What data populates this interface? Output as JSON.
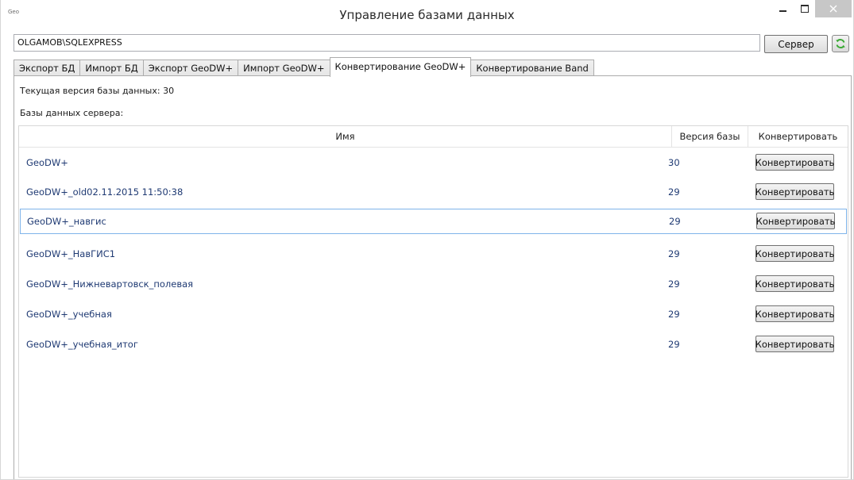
{
  "window": {
    "app_label": "Geo",
    "title": "Управление базами данных"
  },
  "server": {
    "value": "OLGAMOB\\SQLEXPRESS",
    "button_label": "Сервер",
    "refresh_icon": "refresh-icon"
  },
  "tabs": [
    {
      "label": "Экспорт БД",
      "active": false
    },
    {
      "label": "Импорт БД",
      "active": false
    },
    {
      "label": "Экспорт GeoDW+",
      "active": false
    },
    {
      "label": "Импорт GeoDW+",
      "active": false
    },
    {
      "label": "Конвертирование GeoDW+",
      "active": true
    },
    {
      "label": "Конвертирование Band",
      "active": false
    }
  ],
  "panel": {
    "current_version_label": "Текущая версия базы данных: 30",
    "databases_label": "Базы данных сервера:"
  },
  "grid": {
    "headers": {
      "name": "Имя",
      "version": "Версия базы",
      "convert": "Конвертировать"
    },
    "rows": [
      {
        "name": "GeoDW+",
        "version": "30",
        "button": "Конвертировать"
      },
      {
        "name": "GeoDW+_old02.11.2015 11:50:38",
        "version": "29",
        "button": "Конвертировать"
      },
      {
        "name": "GeoDW+_навгис",
        "version": "29",
        "button": "Конвертировать"
      },
      {
        "name": "GeoDW+_НавГИС1",
        "version": "29",
        "button": "Конвертировать"
      },
      {
        "name": "GeoDW+_Нижневартовск_полевая",
        "version": "29",
        "button": "Конвертировать"
      },
      {
        "name": "GeoDW+_учебная",
        "version": "29",
        "button": "Конвертировать"
      },
      {
        "name": "GeoDW+_учебная_итог",
        "version": "29",
        "button": "Конвертировать"
      }
    ],
    "selected_row": 2
  },
  "colors": {
    "row_text": "#1f3a73",
    "selection_border": "#7eb4ea",
    "refresh_green": "#3aa935"
  }
}
